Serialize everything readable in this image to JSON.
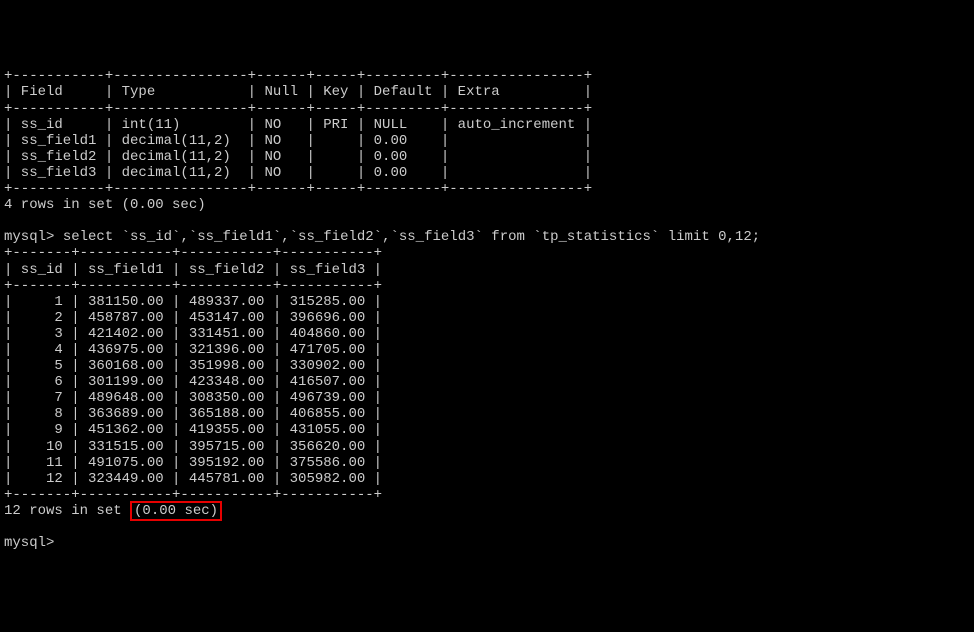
{
  "describe_table": {
    "border_top": "+-----------+----------------+------+-----+---------+----------------+",
    "header_row": "| Field     | Type           | Null | Key | Default | Extra          |",
    "border_mid": "+-----------+----------------+------+-----+---------+----------------+",
    "rows": [
      "| ss_id     | int(11)        | NO   | PRI | NULL    | auto_increment |",
      "| ss_field1 | decimal(11,2)  | NO   |     | 0.00    |                |",
      "| ss_field2 | decimal(11,2)  | NO   |     | 0.00    |                |",
      "| ss_field3 | decimal(11,2)  | NO   |     | 0.00    |                |"
    ],
    "border_bot": "+-----------+----------------+------+-----+---------+----------------+",
    "status": "4 rows in set (0.00 sec)"
  },
  "query_line": {
    "prompt": "mysql>",
    "query": " select `ss_id`,`ss_field1`,`ss_field2`,`ss_field3` from `tp_statistics` limit 0,12;"
  },
  "result_table": {
    "border_top": "+-------+-----------+-----------+-----------+",
    "header_row": "| ss_id | ss_field1 | ss_field2 | ss_field3 |",
    "border_mid": "+-------+-----------+-----------+-----------+",
    "rows": [
      "|     1 | 381150.00 | 489337.00 | 315285.00 |",
      "|     2 | 458787.00 | 453147.00 | 396696.00 |",
      "|     3 | 421402.00 | 331451.00 | 404860.00 |",
      "|     4 | 436975.00 | 321396.00 | 471705.00 |",
      "|     5 | 360168.00 | 351998.00 | 330902.00 |",
      "|     6 | 301199.00 | 423348.00 | 416507.00 |",
      "|     7 | 489648.00 | 308350.00 | 496739.00 |",
      "|     8 | 363689.00 | 365188.00 | 406855.00 |",
      "|     9 | 451362.00 | 419355.00 | 431055.00 |",
      "|    10 | 331515.00 | 395715.00 | 356620.00 |",
      "|    11 | 491075.00 | 395192.00 | 375586.00 |",
      "|    12 | 323449.00 | 445781.00 | 305982.00 |"
    ],
    "border_bot": "+-------+-----------+-----------+-----------+",
    "status_prefix": "12 rows in set ",
    "status_highlight": "(0.00 sec)"
  },
  "final_prompt": "mysql>",
  "chart_data": {
    "type": "table",
    "describe": {
      "columns": [
        "Field",
        "Type",
        "Null",
        "Key",
        "Default",
        "Extra"
      ],
      "rows": [
        [
          "ss_id",
          "int(11)",
          "NO",
          "PRI",
          "NULL",
          "auto_increment"
        ],
        [
          "ss_field1",
          "decimal(11,2)",
          "NO",
          "",
          "0.00",
          ""
        ],
        [
          "ss_field2",
          "decimal(11,2)",
          "NO",
          "",
          "0.00",
          ""
        ],
        [
          "ss_field3",
          "decimal(11,2)",
          "NO",
          "",
          "0.00",
          ""
        ]
      ]
    },
    "select": {
      "columns": [
        "ss_id",
        "ss_field1",
        "ss_field2",
        "ss_field3"
      ],
      "rows": [
        [
          1,
          381150.0,
          489337.0,
          315285.0
        ],
        [
          2,
          458787.0,
          453147.0,
          396696.0
        ],
        [
          3,
          421402.0,
          331451.0,
          404860.0
        ],
        [
          4,
          436975.0,
          321396.0,
          471705.0
        ],
        [
          5,
          360168.0,
          351998.0,
          330902.0
        ],
        [
          6,
          301199.0,
          423348.0,
          416507.0
        ],
        [
          7,
          489648.0,
          308350.0,
          496739.0
        ],
        [
          8,
          363689.0,
          365188.0,
          406855.0
        ],
        [
          9,
          451362.0,
          419355.0,
          431055.0
        ],
        [
          10,
          331515.0,
          395715.0,
          356620.0
        ],
        [
          11,
          491075.0,
          395192.0,
          375586.0
        ],
        [
          12,
          323449.0,
          445781.0,
          305982.0
        ]
      ]
    }
  }
}
